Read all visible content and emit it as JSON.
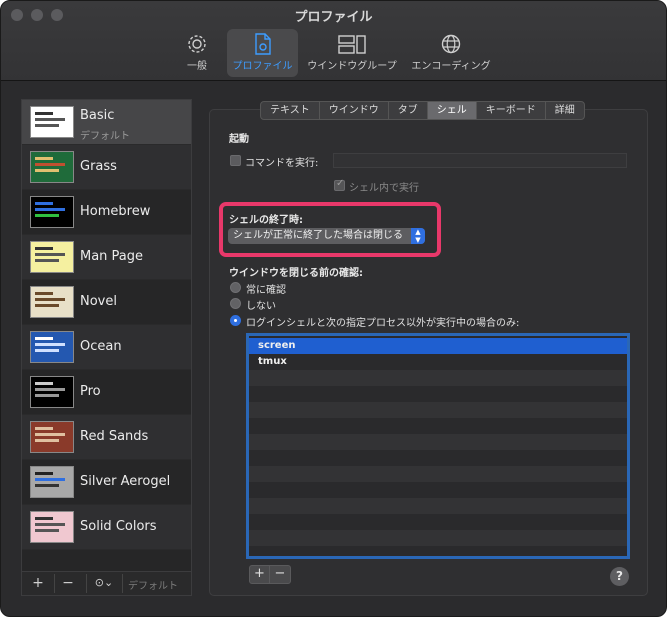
{
  "window": {
    "title": "プロファイル"
  },
  "toolbar": {
    "items": [
      {
        "label": "一般",
        "icon": "gear-icon"
      },
      {
        "label": "プロファイル",
        "icon": "profile-document-icon",
        "active": true
      },
      {
        "label": "ウインドウグループ",
        "icon": "window-group-icon"
      },
      {
        "label": "エンコーディング",
        "icon": "globe-icon"
      }
    ]
  },
  "sidebar": {
    "profiles": [
      {
        "name": "Basic",
        "subtitle": "デフォルト",
        "selected": true,
        "bg": "#ffffff",
        "bar": "#333333"
      },
      {
        "name": "Grass",
        "bg": "#1f6b3a",
        "bar": "#e0c070"
      },
      {
        "name": "Homebrew",
        "bg": "#000000",
        "bar": "#2f6fe0"
      },
      {
        "name": "Man Page",
        "bg": "#f5f0a0",
        "bar": "#333333"
      },
      {
        "name": "Novel",
        "bg": "#e8e0c8",
        "bar": "#6a4a2a"
      },
      {
        "name": "Ocean",
        "bg": "#2458b0",
        "bar": "#ffffff"
      },
      {
        "name": "Pro",
        "bg": "#000000",
        "bar": "#cccccc"
      },
      {
        "name": "Red Sands",
        "bg": "#8a3a2a",
        "bar": "#e0c0a0"
      },
      {
        "name": "Silver Aerogel",
        "bg": "#a8a8a8",
        "bar": "#222222"
      },
      {
        "name": "Solid Colors",
        "bg": "#f0c8d0",
        "bar": "#333333"
      }
    ],
    "footer": {
      "add": "+",
      "remove": "−",
      "action": "⊙⌄",
      "default_label": "デフォルト"
    }
  },
  "tabs": [
    "テキスト",
    "ウインドウ",
    "タブ",
    "シェル",
    "キーボード",
    "詳細"
  ],
  "active_tab": "シェル",
  "startup": {
    "heading": "起動",
    "run_command_label": "コマンドを実行:",
    "run_command_value": "",
    "run_in_shell_label": "シェル内で実行"
  },
  "shell_exit": {
    "heading": "シェルの終了時:",
    "selected_option": "シェルが正常に終了した場合は閉じる"
  },
  "close_confirm": {
    "heading": "ウインドウを閉じる前の確認:",
    "options": [
      "常に確認",
      "しない",
      "ログインシェルと次の指定プロセス以外が実行中の場合のみ:"
    ],
    "selected_index": 2
  },
  "process_list": {
    "items": [
      "screen",
      "tmux"
    ],
    "selected_index": 0,
    "add": "+",
    "remove": "−"
  },
  "help": "?"
}
